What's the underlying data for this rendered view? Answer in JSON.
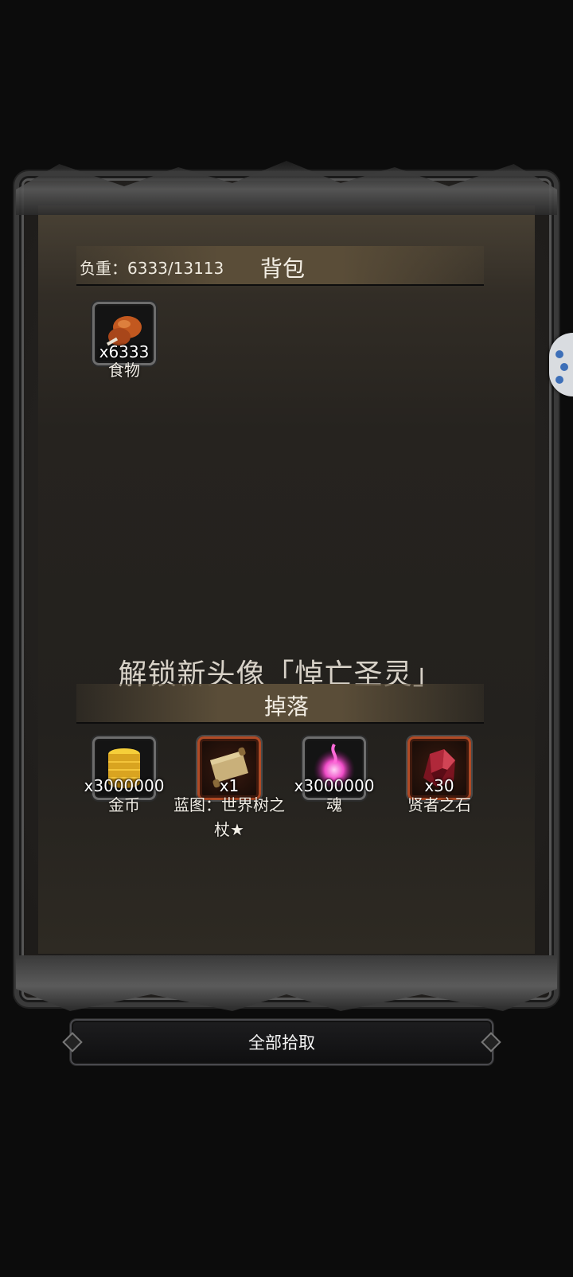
{
  "bag": {
    "title": "背包",
    "weight_label": "负重：6333/13113",
    "items": [
      {
        "quantity": "x6333",
        "name": "食物",
        "icon": "drumstick-icon"
      }
    ]
  },
  "unlock_message": "解锁新头像「悼亡圣灵」",
  "drops": {
    "title": "掉落",
    "items": [
      {
        "quantity": "x3000000",
        "name": "金币",
        "icon": "gold-coins-icon",
        "frame": "gray"
      },
      {
        "quantity": "x1",
        "name": "蓝图：世界树之杖★",
        "icon": "scroll-icon",
        "frame": "red"
      },
      {
        "quantity": "x3000000",
        "name": "魂",
        "icon": "soul-orb-icon",
        "frame": "gray"
      },
      {
        "quantity": "x30",
        "name": "贤者之石",
        "icon": "sage-stone-icon",
        "frame": "red"
      }
    ]
  },
  "collect_all_button": "全部拾取",
  "colors": {
    "accent_bar": "#5a4d38",
    "rare_frame": "#b04a25",
    "background": "#0c0c0c"
  }
}
